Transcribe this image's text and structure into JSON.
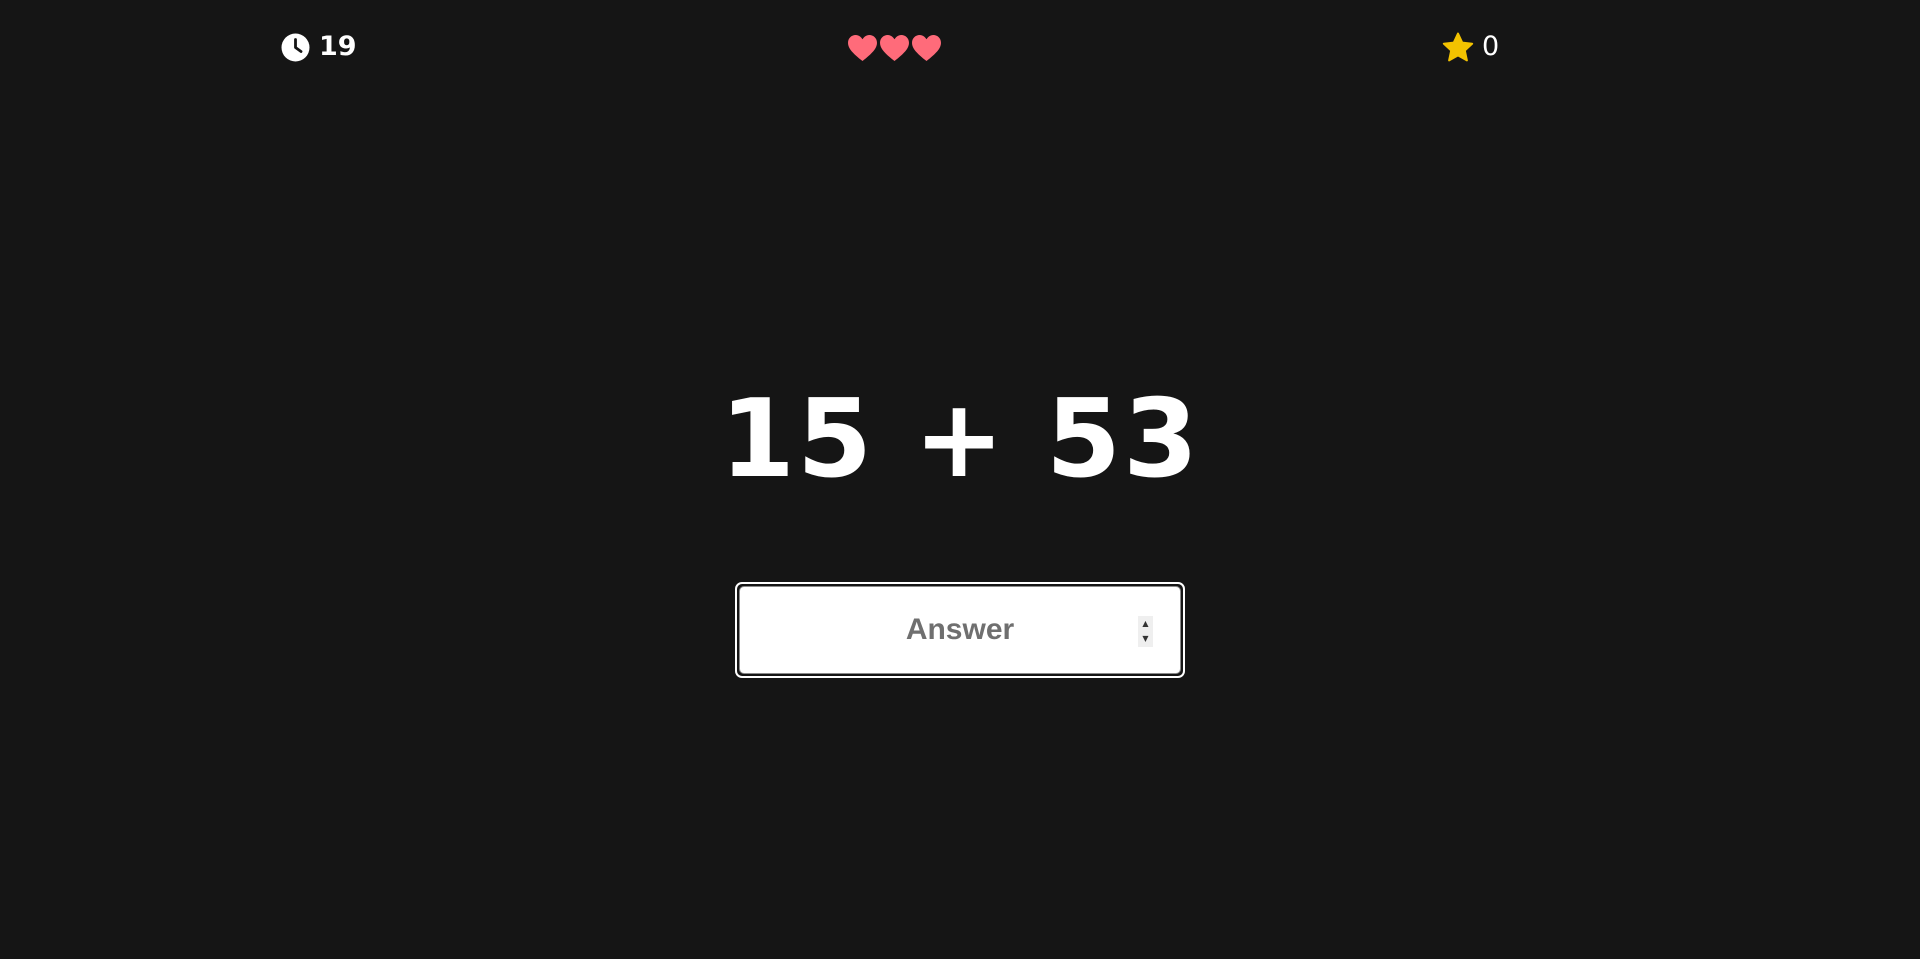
{
  "hud": {
    "timer": {
      "icon": "clock-icon",
      "value": "19"
    },
    "lives": {
      "icon": "heart-icon",
      "count": 3,
      "color": "#ff6b7a"
    },
    "score": {
      "icon": "star-icon",
      "value": "0",
      "color": "#f2c200"
    }
  },
  "problem": {
    "text": "15 + 53"
  },
  "answer": {
    "placeholder": "Answer",
    "value": "",
    "spinner_up": "▲",
    "spinner_down": "▼"
  },
  "colors": {
    "background": "#151515",
    "text": "#ffffff"
  }
}
